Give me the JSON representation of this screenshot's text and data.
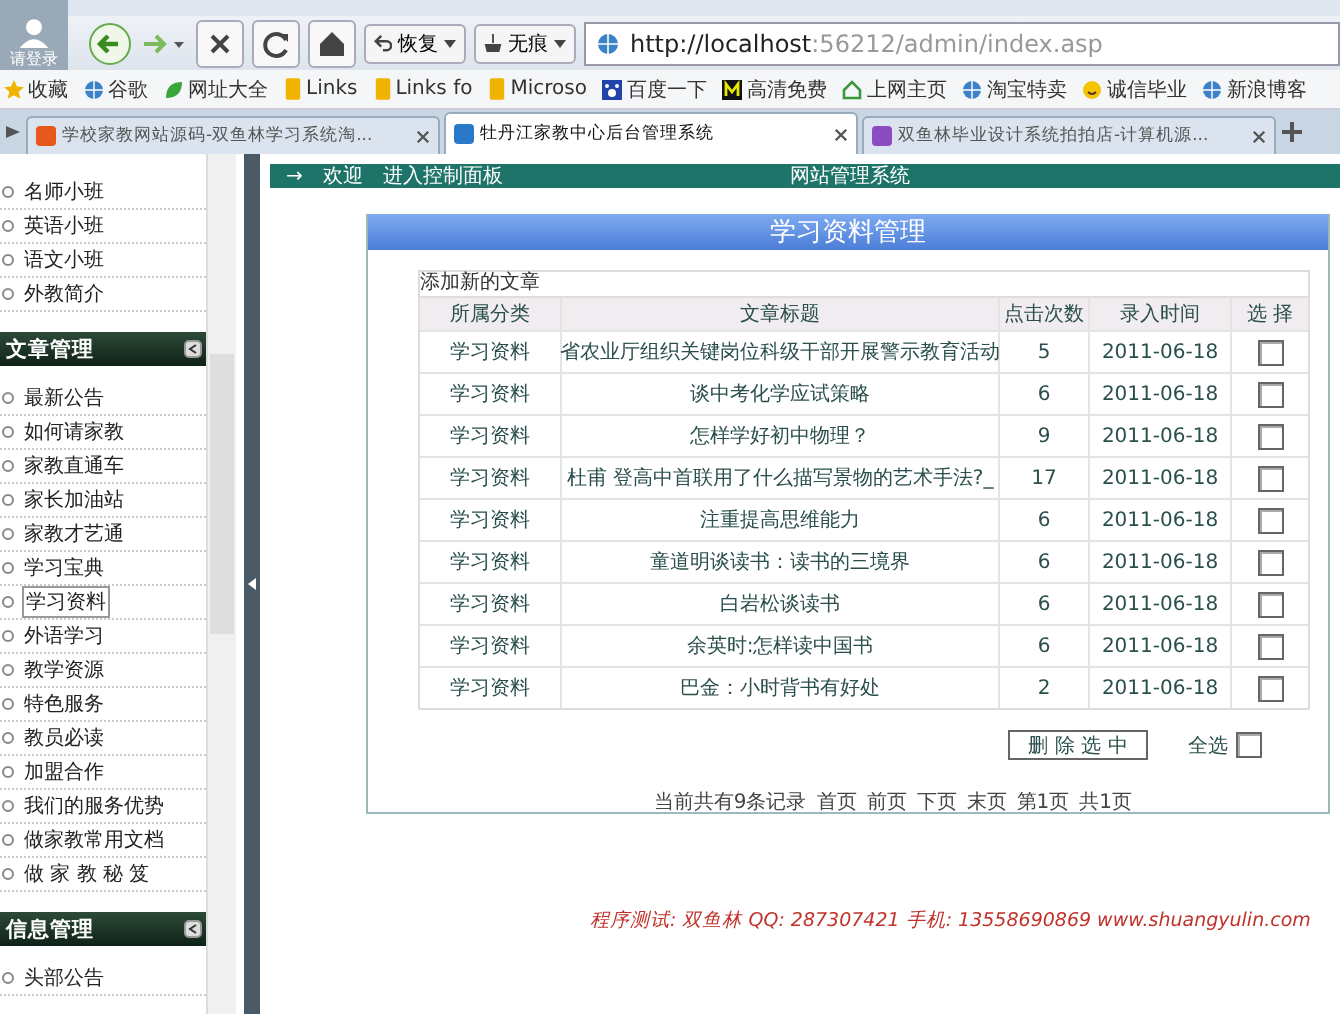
{
  "toolbar": {
    "login": "请登录",
    "restore": "恢复",
    "incognito": "无痕",
    "address_host": "http://localhost",
    "address_rest": ":56212/admin/index.asp"
  },
  "bookmarks": [
    {
      "label": "收藏",
      "kind": "star"
    },
    {
      "label": "谷歌",
      "kind": "globe"
    },
    {
      "label": "网址大全",
      "kind": "leaf"
    },
    {
      "label": "Links",
      "kind": "folder"
    },
    {
      "label": "Links fo",
      "kind": "folder"
    },
    {
      "label": "Microso",
      "kind": "folder"
    },
    {
      "label": "百度一下",
      "kind": "paw"
    },
    {
      "label": "高清免费",
      "kind": "m"
    },
    {
      "label": "上网主页",
      "kind": "house"
    },
    {
      "label": "淘宝特卖",
      "kind": "globe"
    },
    {
      "label": "诚信毕业",
      "kind": "smile"
    },
    {
      "label": "新浪博客",
      "kind": "globe"
    }
  ],
  "tabs": [
    {
      "label": "学校家教网站源码-双鱼林学习系统淘...",
      "selected": false,
      "color": "#e8571c"
    },
    {
      "label": "牡丹江家教中心后台管理系统",
      "selected": true,
      "color": "#2a78c8"
    },
    {
      "label": "双鱼林毕业设计系统拍拍店-计算机源...",
      "selected": false,
      "color": "#8a4cc0"
    }
  ],
  "top_bar": {
    "arrow": "→",
    "welcome": "欢迎",
    "control_panel": "进入控制面板",
    "site": "网站管理系统"
  },
  "sidebar": {
    "items": [
      {
        "label": "名师小班",
        "selected": false
      },
      {
        "label": "英语小班",
        "selected": false
      },
      {
        "label": "语文小班",
        "selected": false
      },
      {
        "label": "外教简介",
        "selected": false
      }
    ],
    "sections": [
      {
        "title": "文章管理",
        "items": [
          {
            "label": "最新公告",
            "selected": false
          },
          {
            "label": "如何请家教",
            "selected": false
          },
          {
            "label": "家教直通车",
            "selected": false
          },
          {
            "label": "家长加油站",
            "selected": false
          },
          {
            "label": "家教才艺通",
            "selected": false
          },
          {
            "label": "学习宝典",
            "selected": false
          },
          {
            "label": "学习资料",
            "selected": true
          },
          {
            "label": "外语学习",
            "selected": false
          },
          {
            "label": "教学资源",
            "selected": false
          },
          {
            "label": "特色服务",
            "selected": false
          },
          {
            "label": "教员必读",
            "selected": false
          },
          {
            "label": "加盟合作",
            "selected": false
          },
          {
            "label": "我们的服务优势",
            "selected": false
          },
          {
            "label": "做家教常用文档",
            "selected": false
          },
          {
            "label": "做 家 教 秘 笈",
            "selected": false
          }
        ]
      },
      {
        "title": "信息管理",
        "items": [
          {
            "label": "头部公告",
            "selected": false
          }
        ]
      }
    ]
  },
  "panel": {
    "title": "学习资料管理",
    "add_link": "添加新的文章",
    "columns": [
      "所属分类",
      "文章标题",
      "点击次数",
      "录入时间",
      "选 择"
    ],
    "rows": [
      {
        "category": "学习资料",
        "title": "省农业厅组织关键岗位科级干部开展警示教育活动",
        "clicks": "5",
        "date": "2011-06-18",
        "checked": false
      },
      {
        "category": "学习资料",
        "title": "谈中考化学应试策略",
        "clicks": "6",
        "date": "2011-06-18",
        "checked": false
      },
      {
        "category": "学习资料",
        "title": "怎样学好初中物理？",
        "clicks": "9",
        "date": "2011-06-18",
        "checked": false
      },
      {
        "category": "学习资料",
        "title": "杜甫 登高中首联用了什么描写景物的艺术手法?_",
        "clicks": "17",
        "date": "2011-06-18",
        "checked": false
      },
      {
        "category": "学习资料",
        "title": "注重提高思维能力",
        "clicks": "6",
        "date": "2011-06-18",
        "checked": false
      },
      {
        "category": "学习资料",
        "title": "童道明谈读书：读书的三境界",
        "clicks": "6",
        "date": "2011-06-18",
        "checked": false
      },
      {
        "category": "学习资料",
        "title": "白岩松谈读书",
        "clicks": "6",
        "date": "2011-06-18",
        "checked": false
      },
      {
        "category": "学习资料",
        "title": "余英时:怎样读中国书",
        "clicks": "6",
        "date": "2011-06-18",
        "checked": false
      },
      {
        "category": "学习资料",
        "title": "巴金：小时背书有好处",
        "clicks": "2",
        "date": "2011-06-18",
        "checked": false
      }
    ],
    "delete_button": "删 除 选 中",
    "select_all": {
      "label": "全选",
      "checked": false
    },
    "pagination": {
      "summary": "当前共有9条记录",
      "links": [
        "首页",
        "前页",
        "下页",
        "末页",
        "第1页",
        "共1页"
      ]
    }
  },
  "footer": "程序测试: 双鱼林  QQ: 287307421  手机: 13558690869  www.shuangyulin.com"
}
